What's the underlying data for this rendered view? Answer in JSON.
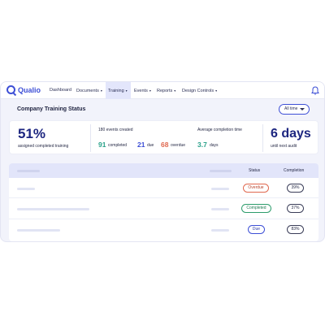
{
  "brand": {
    "name": "Qualio"
  },
  "nav": {
    "items": [
      {
        "label": "Dashboard",
        "has_menu": false,
        "active": false
      },
      {
        "label": "Documents",
        "has_menu": true,
        "active": false
      },
      {
        "label": "Training",
        "has_menu": true,
        "active": true
      },
      {
        "label": "Events",
        "has_menu": true,
        "active": false
      },
      {
        "label": "Reports",
        "has_menu": true,
        "active": false
      },
      {
        "label": "Design Controls",
        "has_menu": true,
        "active": false
      }
    ],
    "caret": "▾",
    "bell_icon": "bell-icon"
  },
  "header": {
    "title": "Company Training Status",
    "filter_label": "All time"
  },
  "stats": {
    "completion_pct": "51%",
    "completion_label": "assigned completed training",
    "events_title": "180 events created",
    "completed_count": "91",
    "completed_label": "completed",
    "due_count": "21",
    "due_label": "due",
    "overdue_count": "68",
    "overdue_label": "overdue",
    "avg_title": "Average completion time",
    "avg_value": "3.7",
    "avg_unit": "days",
    "audit_value": "6 days",
    "audit_label": "until next audit"
  },
  "table": {
    "columns": {
      "status": "Status",
      "completion": "Completion"
    },
    "rows": [
      {
        "status": "Overdue",
        "status_type": "overdue",
        "completion": "39%"
      },
      {
        "status": "Completed",
        "status_type": "completed",
        "completion": "37%"
      },
      {
        "status": "Due",
        "status_type": "due",
        "completion": "83%"
      }
    ]
  },
  "colors": {
    "accent": "#3d4fd6",
    "completed_green": "#2aa18a",
    "due_blue": "#3d4fd6",
    "overdue_orange": "#e0684f"
  }
}
